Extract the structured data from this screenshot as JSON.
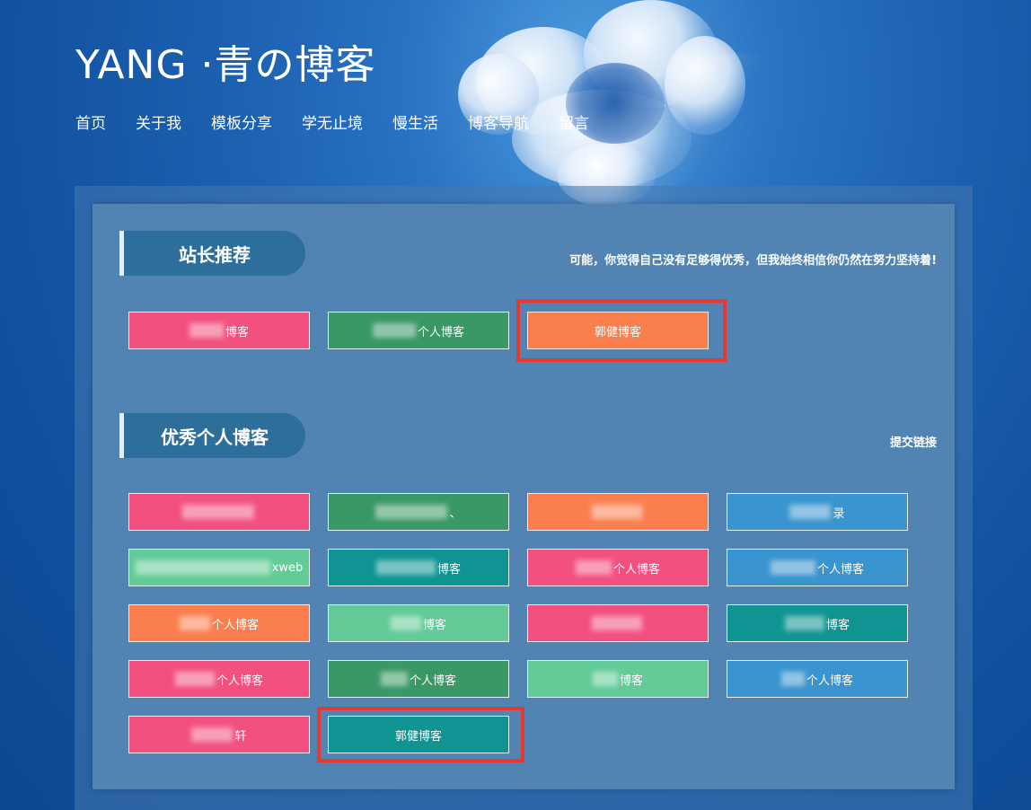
{
  "header": {
    "title": "YANG ·青の博客",
    "nav": [
      "首页",
      "关于我",
      "模板分享",
      "学无止境",
      "慢生活",
      "博客导航",
      "留言"
    ]
  },
  "sections": [
    {
      "title": "站长推荐",
      "note": "可能，你觉得自己没有足够得优秀，但我始终相信你仍然在努力坚持着!"
    },
    {
      "title": "优秀个人博客",
      "note": "提交链接"
    }
  ],
  "recommended": [
    {
      "label": "博客",
      "color": "pink"
    },
    {
      "label": "个人博客",
      "color": "green"
    },
    {
      "label": "郭健博客",
      "color": "orange"
    }
  ],
  "blogs": [
    {
      "label": "",
      "color": "pink"
    },
    {
      "label": "、",
      "color": "green"
    },
    {
      "label": "",
      "color": "orange"
    },
    {
      "label": "录",
      "color": "blue"
    },
    {
      "label": "xweb",
      "color": "lgreen"
    },
    {
      "label": "博客",
      "color": "teal"
    },
    {
      "label": "个人博客",
      "color": "pink"
    },
    {
      "label": "个人博客",
      "color": "blue"
    },
    {
      "label": "个人博客",
      "color": "orange"
    },
    {
      "label": "博客",
      "color": "lgreen"
    },
    {
      "label": "",
      "color": "pink"
    },
    {
      "label": "博客",
      "color": "teal"
    },
    {
      "label": "个人博客",
      "color": "pink"
    },
    {
      "label": "个人博客",
      "color": "green"
    },
    {
      "label": "博客",
      "color": "lgreen"
    },
    {
      "label": "个人博客",
      "color": "blue"
    },
    {
      "label": "轩",
      "color": "pink"
    },
    {
      "label": "郭健博客",
      "color": "teal"
    }
  ],
  "colors": {
    "pink": "#f2517f",
    "green": "#3a9866",
    "orange": "#fb7f4e",
    "blue": "#3a94cf",
    "lgreen": "#62cb97",
    "teal": "#0f9493",
    "highlight": "#e8372f"
  }
}
